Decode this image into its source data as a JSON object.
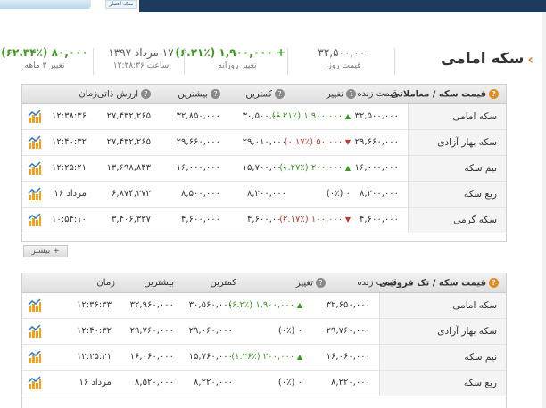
{
  "banner": {
    "logo_text": "سکه اعتبار"
  },
  "page": {
    "title": "سکه امامی"
  },
  "summary": {
    "day_price_value": "۳۲,۵۰۰,۰۰۰",
    "day_price_label": "قیمت روز",
    "daily_change_value": "+ ۱,۹۰۰,۰۰۰ (۶.۲۱٪)",
    "daily_change_label": "تغییر روزانه",
    "date_value": "۱۷ مرداد ۱۳۹۷",
    "time_label": "ساعت ۱۲:۳۸:۳۶",
    "three_month_value": "۸۰,۰۰۰ (۶۲.۳۴٪)",
    "three_month_label": "تغییر ۳ ماهه"
  },
  "table1": {
    "headers": {
      "title": "قیمت سکه / معاملاتی",
      "live": "قیمت زنده",
      "change": "تغییر",
      "min": "کمترین",
      "max": "بیشترین",
      "intrinsic": "ارزش ذاتی",
      "time": "زمان"
    },
    "rows": [
      {
        "name": "سکه امامی",
        "live": "۳۲,۵۰۰,۰۰۰",
        "change": "(۶.۲۱٪) ۱,۹۰۰,۰۰۰",
        "dir": "up",
        "min": "۳۰,۵۰۰,۰۰۰",
        "max": "۳۲,۸۵۰,۰۰۰",
        "intrinsic": "۲۷,۴۳۲,۲۶۵",
        "time": "۱۲:۳۸:۳۶"
      },
      {
        "name": "سکه بهار آزادی",
        "live": "۲۹,۶۶۰,۰۰۰",
        "change": "(۰.۱۷٪) ۵۰,۰۰۰",
        "dir": "down",
        "min": "۲۹,۰۱۰,۰۰۰",
        "max": "۲۹,۶۶۰,۰۰۰",
        "intrinsic": "۲۷,۴۳۲,۲۶۵",
        "time": "۱۲:۴۰:۳۲"
      },
      {
        "name": "نیم سکه",
        "live": "۱۶,۰۰۰,۰۰۰",
        "change": "(۱.۲۷٪) ۲۰۰,۰۰۰",
        "dir": "up",
        "min": "۱۵,۷۰۰,۰۰۰",
        "max": "۱۶,۰۰۰,۰۰۰",
        "intrinsic": "۱۳,۶۹۸,۸۴۳",
        "time": "۱۲:۲۵:۲۱"
      },
      {
        "name": "ربع سکه",
        "live": "۸,۲۰۰,۰۰۰",
        "change": "(۰٪) ۰",
        "dir": "none",
        "min": "۸,۲۰۰,۰۰۰",
        "max": "۸,۵۰۰,۰۰۰",
        "intrinsic": "۶,۸۷۴,۲۷۲",
        "time": "۱۶ مرداد"
      },
      {
        "name": "سکه گرمی",
        "live": "۴,۶۰۰,۰۰۰",
        "change": "(۲.۱۷٪) ۱۰۰,۰۰۰",
        "dir": "down",
        "min": "۴,۶۰۰,۰۰۰",
        "max": "۴,۶۰۰,۰۰۰",
        "intrinsic": "۳,۴۰۶,۳۳۷",
        "time": "۱۰:۵۴:۱۰"
      }
    ],
    "more_label": "+ بیشتر"
  },
  "table2": {
    "headers": {
      "title": "قیمت سکه / تک فروشی",
      "live": "قیمت زنده",
      "change": "تغییر",
      "min": "کمترین",
      "max": "بیشترین",
      "time": "زمان"
    },
    "rows": [
      {
        "name": "سکه امامی",
        "live": "۳۲,۶۵۰,۰۰۰",
        "change": "(۶.۲٪) ۱,۹۰۰,۰۰۰",
        "dir": "up",
        "min": "۳۰,۵۶۰,۰۰۰",
        "max": "۳۲,۹۶۰,۰۰۰",
        "time": "۱۲:۳۶:۳۳"
      },
      {
        "name": "سکه بهار آزادی",
        "live": "۲۹,۷۶۰,۰۰۰",
        "change": "(۰٪) ۰",
        "dir": "none",
        "min": "۲۹,۰۶۰,۰۰۰",
        "max": "۲۹,۷۶۰,۰۰۰",
        "time": "۱۲:۴۰:۳۲"
      },
      {
        "name": "نیم سکه",
        "live": "۱۶,۰۶۰,۰۰۰",
        "change": "(۱.۲۶٪) ۲۰۰,۰۰۰",
        "dir": "up",
        "min": "۱۵,۷۶۰,۰۰۰",
        "max": "۱۶,۰۶۰,۰۰۰",
        "time": "۱۲:۲۵:۲۱"
      },
      {
        "name": "ربع سکه",
        "live": "۸,۲۲۰,۰۰۰",
        "change": "(۰٪) ۰",
        "dir": "none",
        "min": "۸,۲۲۰,۰۰۰",
        "max": "۸,۵۲۰,۰۰۰",
        "time": "۱۶ مرداد"
      }
    ]
  },
  "colors": {
    "up": "#3a9a1c",
    "down": "#c0392b",
    "accent": "#e07b1a",
    "banner": "#1e3a5c"
  }
}
